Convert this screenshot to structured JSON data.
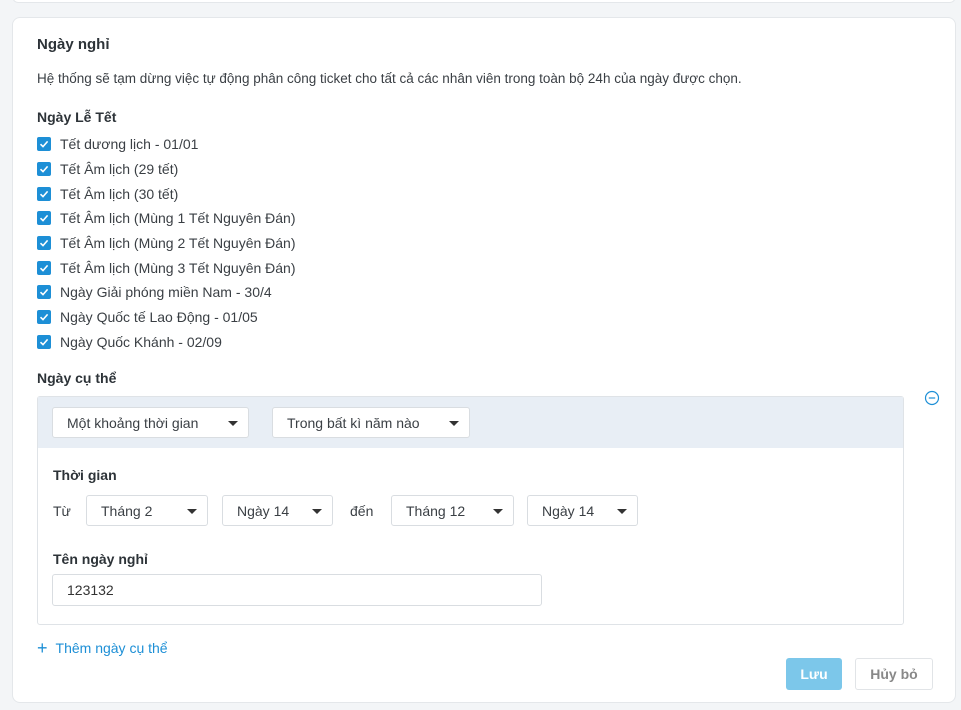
{
  "section": {
    "title": "Ngày nghỉ",
    "description": "Hệ thống sẽ tạm dừng việc tự động phân công ticket cho tất cả các nhân viên trong toàn bộ 24h của ngày được chọn."
  },
  "holidays": {
    "label": "Ngày Lễ Tết",
    "items": [
      {
        "label": "Tết dương lịch - 01/01",
        "checked": true
      },
      {
        "label": "Tết Âm lịch (29 tết)",
        "checked": true
      },
      {
        "label": "Tết Âm lịch (30 tết)",
        "checked": true
      },
      {
        "label": "Tết Âm lịch (Mùng 1 Tết Nguyên Đán)",
        "checked": true
      },
      {
        "label": "Tết Âm lịch (Mùng 2 Tết Nguyên Đán)",
        "checked": true
      },
      {
        "label": "Tết Âm lịch (Mùng 3 Tết Nguyên Đán)",
        "checked": true
      },
      {
        "label": "Ngày Giải phóng miền Nam - 30/4",
        "checked": true
      },
      {
        "label": "Ngày Quốc tế Lao Động - 01/05",
        "checked": true
      },
      {
        "label": "Ngày Quốc Khánh - 02/09",
        "checked": true
      }
    ]
  },
  "specific": {
    "label": "Ngày cụ thể",
    "range_type": "Một khoảng thời gian",
    "year_type": "Trong bất kì năm nào",
    "time_label": "Thời gian",
    "from_label": "Từ",
    "from_month": "Tháng 2",
    "from_day": "Ngày 14",
    "to_label": "đến",
    "to_month": "Tháng 12",
    "to_day": "Ngày 14",
    "name_label": "Tên ngày nghỉ",
    "name_value": "123132",
    "add_label": "Thêm ngày cụ thể"
  },
  "actions": {
    "save": "Lưu",
    "cancel": "Hủy bỏ"
  },
  "colors": {
    "accent": "#1d8fd6",
    "save_button": "#7cc7ea",
    "header_bg": "#e8eef5"
  },
  "icons": {
    "check": "check-icon",
    "remove": "minus-circle-icon",
    "add": "plus-icon",
    "caret": "chevron-down-icon"
  }
}
